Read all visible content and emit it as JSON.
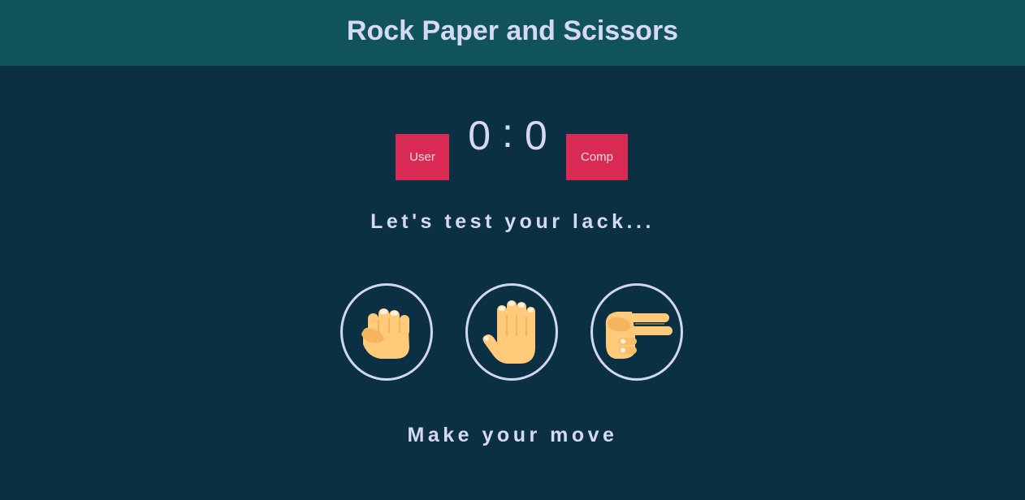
{
  "header": {
    "title": "Rock Paper and Scissors"
  },
  "scoreboard": {
    "user_label": "User",
    "comp_label": "Comp",
    "user_score": "0",
    "separator": ":",
    "comp_score": "0"
  },
  "result_message": "Let's test your lack...",
  "action_message": "Make your move",
  "choices": [
    {
      "id": "rock",
      "icon": "fist-icon"
    },
    {
      "id": "paper",
      "icon": "raised-hand-icon"
    },
    {
      "id": "scissors",
      "icon": "victory-hand-icon"
    }
  ],
  "colors": {
    "background": "#0b3044",
    "header": "#10535a",
    "badge": "#d92a54",
    "text": "#d6d9f1",
    "skin": "#ffca7a"
  }
}
